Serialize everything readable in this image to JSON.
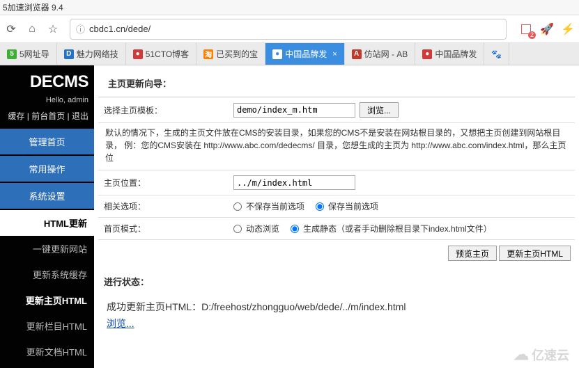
{
  "window": {
    "title": "5加速浏览器 9.4"
  },
  "address": {
    "lock_icon": "ⓘ",
    "url": "cbdc1.cn/dede/"
  },
  "toolbar": {
    "badge_count": "2"
  },
  "tabs": [
    {
      "label": "5网址导"
    },
    {
      "label": "魅力网络技"
    },
    {
      "label": "51CTO博客"
    },
    {
      "label": "已买到的宝"
    },
    {
      "label": "中国品牌发"
    },
    {
      "label": "仿站网 - AB"
    },
    {
      "label": "中国品牌发"
    },
    {
      "label": ""
    }
  ],
  "sidebar": {
    "logo": "DECMS",
    "hello": "Hello, admin",
    "links": "缓存 | 前台首页 | 退出",
    "btn1": "管理首页",
    "btn2": "常用操作",
    "btn3": "系统设置",
    "cat": "HTML更新",
    "items": [
      "一键更新网站",
      "更新系统缓存",
      "更新主页HTML",
      "更新栏目HTML",
      "更新文档HTML"
    ]
  },
  "panel": {
    "title": "主页更新向导：",
    "row1_label": "选择主页模板：",
    "row1_value": "demo/index_m.htm",
    "row1_btn": "浏览...",
    "hint": "默认的情况下，生成的主页文件放在CMS的安装目录，如果您的CMS不是安装在网站根目录的，又想把主页创建到网站根目录，\n例：您的CMS安装在 http://www.abc.com/dedecms/ 目录，您想生成的主页为 http://www.abc.com/index.html，那么主页位",
    "row2_label": "主页位置：",
    "row2_value": "../m/index.html",
    "row3_label": "相关选项：",
    "row3_opt1": "不保存当前选项",
    "row3_opt2": "保存当前选项",
    "row4_label": "首页模式：",
    "row4_opt1": "动态浏览",
    "row4_opt2": "生成静态（或者手动删除根目录下index.html文件）",
    "action1": "预览主页",
    "action2": "更新主页HTML",
    "progress_label": "进行状态：",
    "result_text": "成功更新主页HTML：D:/freehost/zhongguo/web/dede/../m/index.html",
    "result_link": "浏览..."
  },
  "watermark": "亿速云"
}
